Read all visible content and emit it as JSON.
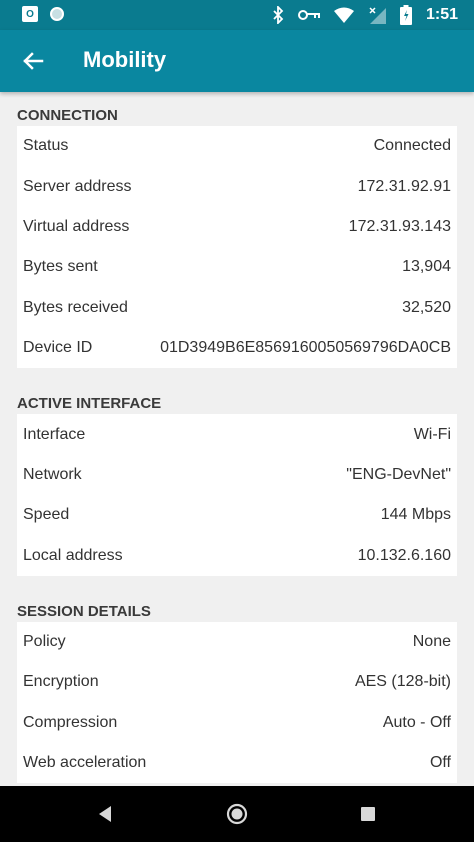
{
  "status_bar": {
    "time": "1:51",
    "outlook_letter": "O"
  },
  "app_bar": {
    "title": "Mobility"
  },
  "sections": [
    {
      "header": "CONNECTION",
      "rows": [
        {
          "label": "Status",
          "value": "Connected"
        },
        {
          "label": "Server address",
          "value": "172.31.92.91"
        },
        {
          "label": "Virtual address",
          "value": "172.31.93.143"
        },
        {
          "label": "Bytes sent",
          "value": "13,904"
        },
        {
          "label": "Bytes received",
          "value": "32,520"
        },
        {
          "label": "Device ID",
          "value": "01D3949B6E8569160050569796DA0CB"
        }
      ]
    },
    {
      "header": "ACTIVE INTERFACE",
      "rows": [
        {
          "label": "Interface",
          "value": "Wi-Fi"
        },
        {
          "label": "Network",
          "value": "\"ENG-DevNet\""
        },
        {
          "label": "Speed",
          "value": "144 Mbps"
        },
        {
          "label": "Local address",
          "value": "10.132.6.160"
        }
      ]
    },
    {
      "header": "SESSION DETAILS",
      "rows": [
        {
          "label": "Policy",
          "value": "None"
        },
        {
          "label": "Encryption",
          "value": "AES (128-bit)"
        },
        {
          "label": "Compression",
          "value": "Auto - Off"
        },
        {
          "label": "Web acceleration",
          "value": "Off"
        }
      ]
    }
  ],
  "colors": {
    "status_bar": "#0a7b8f",
    "app_bar": "#0a87a0",
    "background": "#f0f0f0"
  },
  "icons": [
    "outlook-icon",
    "notification-dot-icon",
    "bluetooth-icon",
    "vpn-key-icon",
    "wifi-icon",
    "signal-icon",
    "battery-icon",
    "back-arrow-icon",
    "nav-back-icon",
    "nav-home-icon",
    "nav-recents-icon"
  ]
}
